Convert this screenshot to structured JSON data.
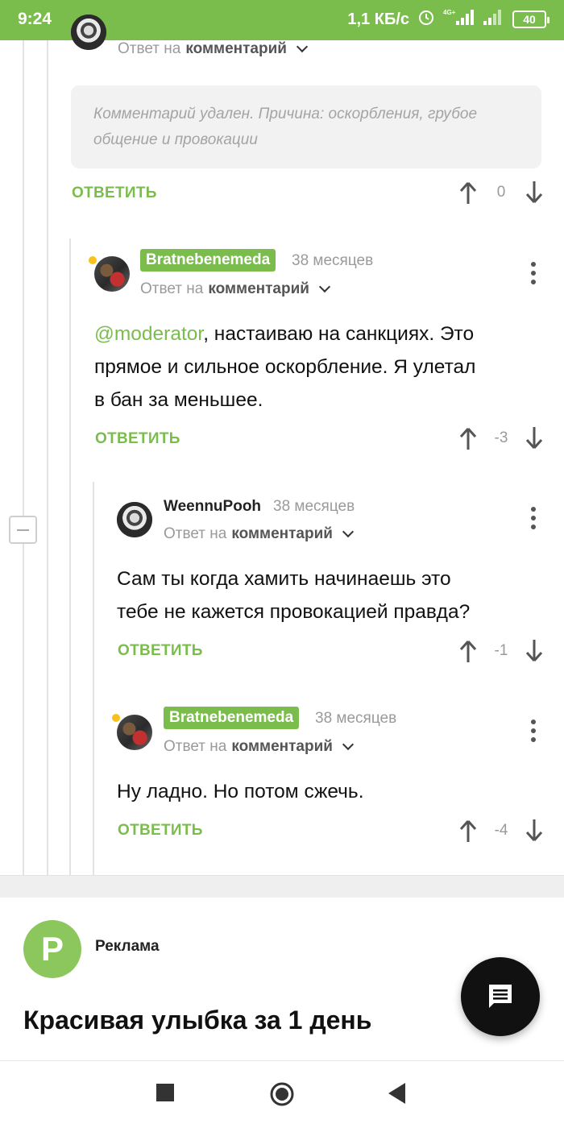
{
  "status_bar": {
    "time": "9:24",
    "network_speed": "1,1 КБ/с",
    "battery": "40",
    "icons": [
      "alarm-icon",
      "signal-4g-icon",
      "signal-icon",
      "battery-icon"
    ]
  },
  "colors": {
    "accent": "#7bbd4d",
    "muted": "#9a9a9a",
    "deleted_bg": "#f2f2f2"
  },
  "top_partial": {
    "reply_to_prefix": "Ответ на",
    "reply_to_link": "комментарий"
  },
  "deleted_comment": {
    "text": "Комментарий удален. Причина: оскорбления, грубое общение и провокации",
    "reply_label": "ОТВЕТИТЬ",
    "score": "0"
  },
  "comments": [
    {
      "author": "Bratnebenemeda",
      "age": "38 месяцев",
      "reply_to_prefix": "Ответ на",
      "reply_to_link": "комментарий",
      "mention": "@moderator",
      "text_line1": ", настаиваю на санкциях. Это",
      "text_line2": "прямое и сильное оскорбление. Я улетал",
      "text_line3": "в бан за меньшее.",
      "reply_label": "ОТВЕТИТЬ",
      "score": "-3"
    },
    {
      "author": "WeennuPooh",
      "age": "38 месяцев",
      "reply_to_prefix": "Ответ на",
      "reply_to_link": "комментарий",
      "text_line1": "Сам ты когда хамить начинаешь это",
      "text_line2": "тебе не кажется провокацией правда?",
      "reply_label": "ОТВЕТИТЬ",
      "score": "-1"
    },
    {
      "author": "Bratnebenemeda",
      "age": "38 месяцев",
      "reply_to_prefix": "Ответ на",
      "reply_to_link": "комментарий",
      "text_line1": "Ну ладно. Но потом сжечь.",
      "reply_label": "ОТВЕТИТЬ",
      "score": "-4"
    }
  ],
  "ad": {
    "logo_letter": "P",
    "label": "Реклама",
    "title": "Красивая улыбка за 1 день"
  },
  "nav_icons": [
    "recents-square-icon",
    "home-circle-icon",
    "back-triangle-icon"
  ]
}
